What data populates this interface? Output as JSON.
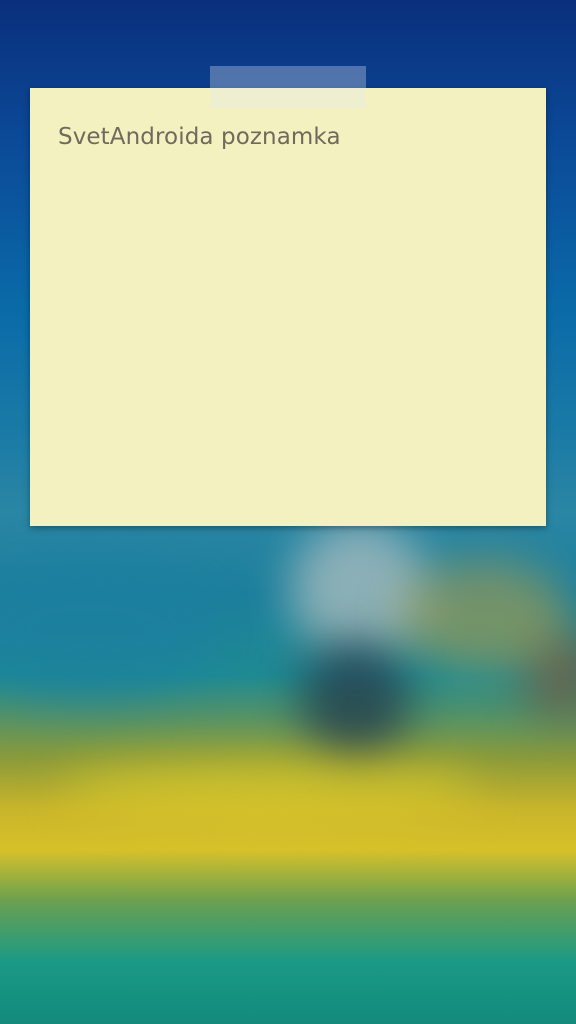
{
  "note": {
    "text": "SvetAndroida poznamka",
    "background_color": "#f4f1c1",
    "text_color": "#6e6a5c"
  },
  "wallpaper": {
    "top_color": "#0a2f7c",
    "accent_yellow": "#d6c12a",
    "bottom_color": "#138a7c"
  }
}
